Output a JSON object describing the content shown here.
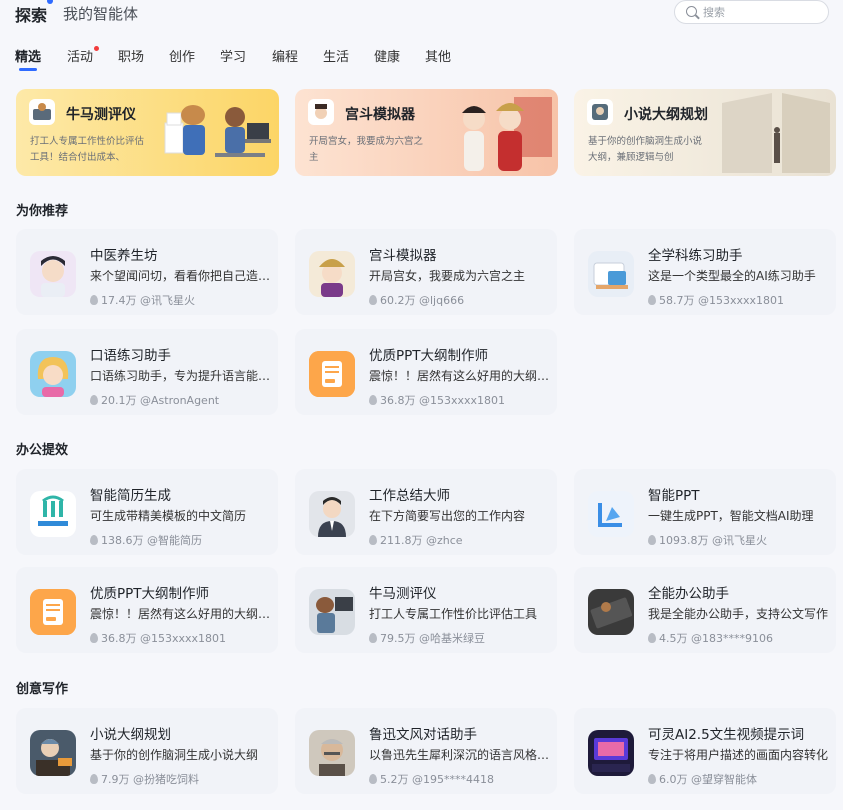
{
  "header": {
    "title": "探索",
    "subtitle": "我的智能体",
    "search_placeholder": "搜索"
  },
  "tabs": [
    {
      "label": "精选",
      "active": true
    },
    {
      "label": "活动",
      "badge": true
    },
    {
      "label": "职场"
    },
    {
      "label": "创作"
    },
    {
      "label": "学习"
    },
    {
      "label": "编程"
    },
    {
      "label": "生活"
    },
    {
      "label": "健康"
    },
    {
      "label": "其他"
    }
  ],
  "banners": [
    {
      "title": "牛马测评仪",
      "desc": "打工人专属工作性价比评估工具！结合付出成本、",
      "color": "#fde08a"
    },
    {
      "title": "宫斗模拟器",
      "desc": "开局宫女，我要成为六宫之主",
      "color": "#fbd7c0"
    },
    {
      "title": "小说大纲规划",
      "desc": "基于你的创作脑洞生成小说大纲，兼顾逻辑与创",
      "color": "#f3ead8"
    }
  ],
  "sections": {
    "recommend": "为你推荐",
    "office": "办公提效",
    "writing": "创意写作"
  },
  "recommend_cards": [
    {
      "name": "中医养生坊",
      "desc": "来个望闻问切，看看你把自己造成啥样了",
      "heat": "17.4万",
      "author": "@讯飞星火"
    },
    {
      "name": "宫斗模拟器",
      "desc": "开局宫女，我要成为六宫之主",
      "heat": "60.2万",
      "author": "@ljq666"
    },
    {
      "name": "全学科练习助手",
      "desc": "这是一个类型最全的AI练习助手",
      "heat": "58.7万",
      "author": "@153xxxx1801"
    },
    {
      "name": "口语练习助手",
      "desc": "口语练习助手，专为提升语言能力设计",
      "heat": "20.1万",
      "author": "@AstronAgent"
    },
    {
      "name": "优质PPT大纲制作师",
      "desc": "震惊！！居然有这么好用的大纲工具",
      "heat": "36.8万",
      "author": "@153xxxx1801"
    }
  ],
  "office_cards": [
    {
      "name": "智能简历生成",
      "desc": "可生成带精美模板的中文简历",
      "heat": "138.6万",
      "author": "@智能简历"
    },
    {
      "name": "工作总结大师",
      "desc": "在下方简要写出您的工作内容",
      "heat": "211.8万",
      "author": "@zhce"
    },
    {
      "name": "智能PPT",
      "desc": "一键生成PPT，智能文档AI助理",
      "heat": "1093.8万",
      "author": "@讯飞星火"
    },
    {
      "name": "优质PPT大纲制作师",
      "desc": "震惊！！居然有这么好用的大纲工具",
      "heat": "36.8万",
      "author": "@153xxxx1801"
    },
    {
      "name": "牛马测评仪",
      "desc": "打工人专属工作性价比评估工具",
      "heat": "79.5万",
      "author": "@哈基米绿豆"
    },
    {
      "name": "全能办公助手",
      "desc": "我是全能办公助手，支持公文写作",
      "heat": "4.5万",
      "author": "@183****9106"
    }
  ],
  "writing_cards": [
    {
      "name": "小说大纲规划",
      "desc": "基于你的创作脑洞生成小说大纲",
      "heat": "7.9万",
      "author": "@扮猪吃饲料"
    },
    {
      "name": "鲁迅文风对话助手",
      "desc": "以鲁迅先生犀利深沉的语言风格对话",
      "heat": "5.2万",
      "author": "@195****4418"
    },
    {
      "name": "可灵AI2.5文生视频提示词",
      "desc": "专注于将用户描述的画面内容转化",
      "heat": "6.0万",
      "author": "@望穿智能体"
    }
  ],
  "colors": {
    "accent": "#2f6bff",
    "badge": "#f23c3c",
    "card_bg": "#f1f3f8"
  }
}
